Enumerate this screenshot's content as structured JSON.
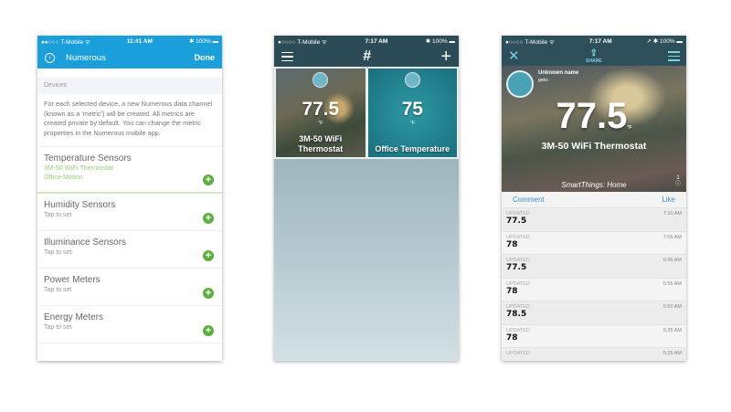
{
  "phone1": {
    "status": {
      "carrier": "●●○○○ T-Mobile ᯤ",
      "time": "11:41 AM",
      "battery": "✱ 100% ▬"
    },
    "nav": {
      "back_icon": "chevron-left-circle",
      "title": "Numerous",
      "done": "Done"
    },
    "section": "Devices",
    "description": "For each selected device, a new Numerous data channel (known as a 'metric') will be created. All metrics are created private by default. You can change the metric properties in the Numerous mobile app.",
    "first": {
      "name": "Temperature Sensors",
      "selected": [
        "3M-50 WiFi Thermostat",
        "Office Motion"
      ]
    },
    "rows": [
      {
        "name": "Humidity Sensors",
        "sub": "Tap to set"
      },
      {
        "name": "Illuminance Sensors",
        "sub": "Tap to set"
      },
      {
        "name": "Power Meters",
        "sub": "Tap to set"
      },
      {
        "name": "Energy Meters",
        "sub": "Tap to set"
      }
    ],
    "accent": "#1b9fdb",
    "add_color": "#5cae3e"
  },
  "phone2": {
    "status": {
      "carrier": "●○○○○ T-Mobile ᯤ",
      "time": "7:17 AM",
      "battery": "✱ 100% ▬"
    },
    "nav": {
      "logo": "#",
      "plus": "+"
    },
    "tiles": [
      {
        "value": "77.5",
        "unit": "°F",
        "name": "3M-50 WiFi Thermostat"
      },
      {
        "value": "75",
        "unit": "°F",
        "name": "Office Temperature"
      }
    ]
  },
  "phone3": {
    "status": {
      "carrier": "●○○○○ T-Mobile ᯤ",
      "time": "7:17 AM",
      "battery": "➚ ✱ 100% ▬"
    },
    "nav": {
      "close": "✕",
      "share": "SHARE"
    },
    "user": {
      "name": "Unknown name",
      "login": "geko"
    },
    "value": "77.5",
    "unit": "°F",
    "device": "3M-50 WiFi Thermostat",
    "location": "SmartThings: Home",
    "count": "1",
    "actions": {
      "comment": "Comment",
      "like": "Like"
    },
    "entries": [
      {
        "label": "UPDATED",
        "time": "7:10 AM",
        "value": "77.5"
      },
      {
        "label": "UPDATED",
        "time": "7:05 AM",
        "value": "78"
      },
      {
        "label": "UPDATED",
        "time": "6:45 AM",
        "value": "77.5"
      },
      {
        "label": "UPDATED",
        "time": "5:55 AM",
        "value": "78"
      },
      {
        "label": "UPDATED",
        "time": "5:50 AM",
        "value": "78.5"
      },
      {
        "label": "UPDATED",
        "time": "5:35 AM",
        "value": "78"
      },
      {
        "label": "UPDATED",
        "time": "5:25 AM",
        "value": ""
      }
    ]
  }
}
